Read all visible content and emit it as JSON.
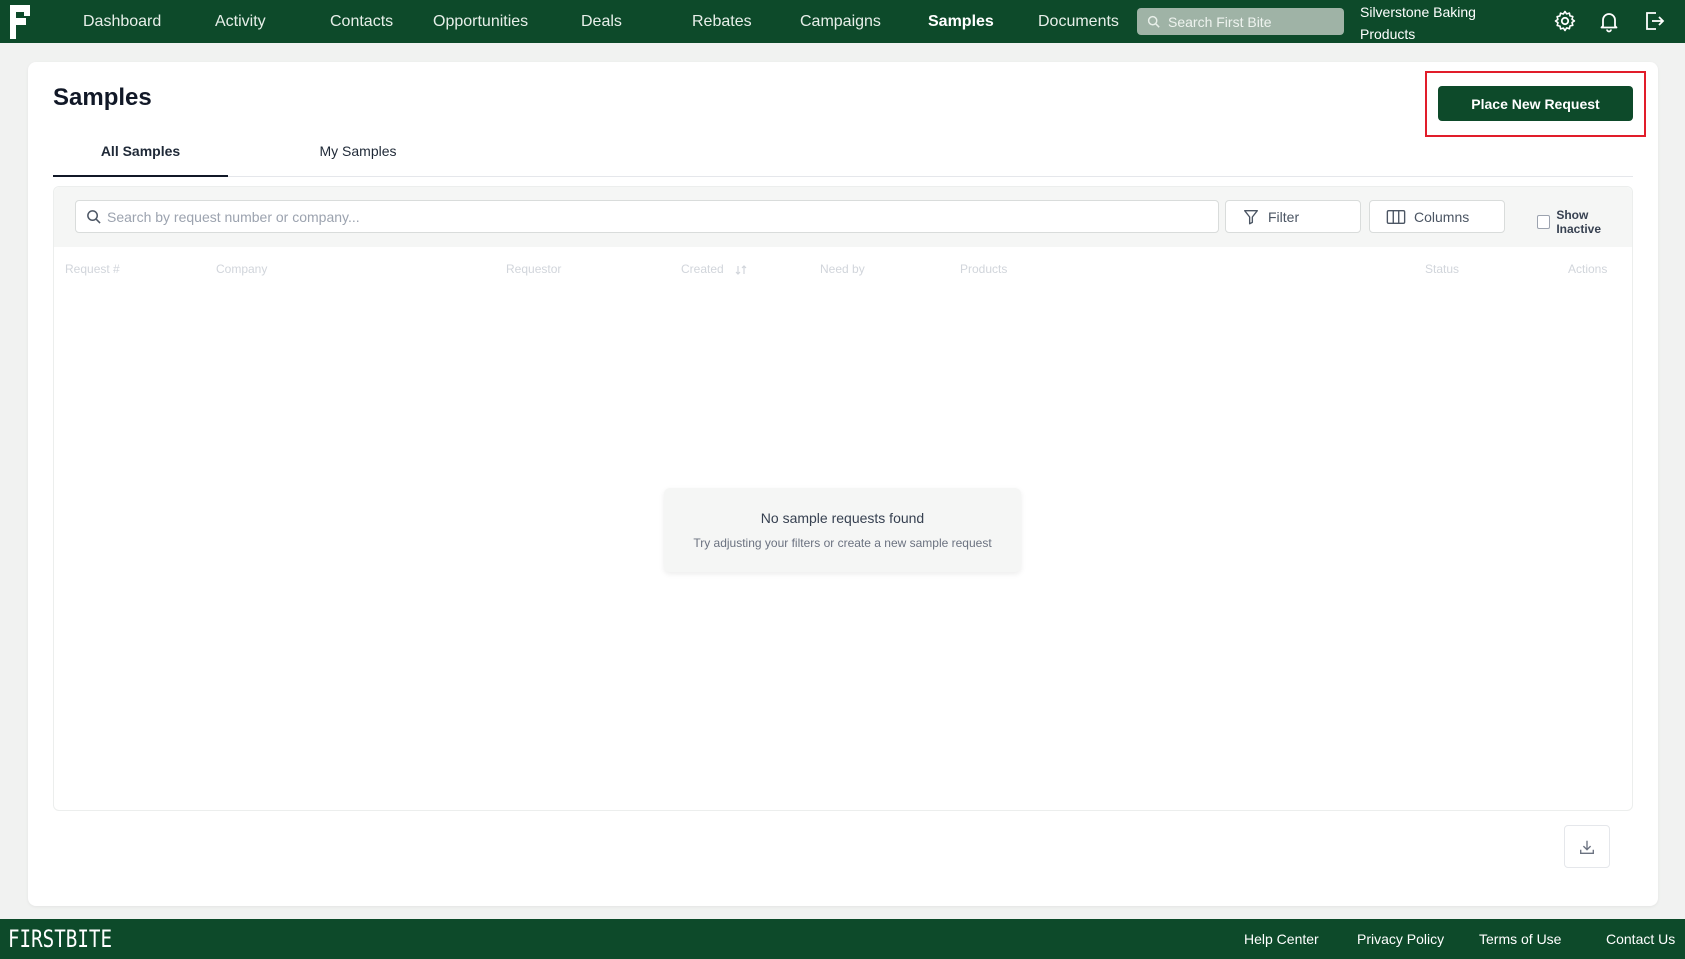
{
  "nav": {
    "items": [
      {
        "label": "Dashboard",
        "active": false
      },
      {
        "label": "Activity",
        "active": false
      },
      {
        "label": "Contacts",
        "active": false
      },
      {
        "label": "Opportunities",
        "active": false
      },
      {
        "label": "Deals",
        "active": false
      },
      {
        "label": "Rebates",
        "active": false
      },
      {
        "label": "Campaigns",
        "active": false
      },
      {
        "label": "Samples",
        "active": true
      },
      {
        "label": "Documents",
        "active": false
      }
    ],
    "search_placeholder": "Search First Bite",
    "org_name": "Silverstone Baking Products",
    "icons": [
      "gear-icon",
      "bell-icon",
      "logout-icon"
    ]
  },
  "page": {
    "title": "Samples",
    "primary_action": "Place New Request",
    "tabs": [
      {
        "label": "All Samples",
        "active": true
      },
      {
        "label": "My Samples",
        "active": false
      }
    ]
  },
  "table": {
    "search_placeholder": "Search by request number or company...",
    "filter_label": "Filter",
    "columns_label": "Columns",
    "show_inactive_label": "Show Inactive",
    "show_inactive_checked": false,
    "columns": [
      "Request #",
      "Company",
      "Requestor",
      "Created",
      "Need by",
      "Products",
      "Status",
      "Actions"
    ],
    "empty_title": "No sample requests found",
    "empty_subtitle": "Try adjusting your filters or create a new sample request"
  },
  "footer": {
    "brand": "FIRSTBITE",
    "links": [
      "Help Center",
      "Privacy Policy",
      "Terms of Use",
      "Contact Us"
    ]
  },
  "colors": {
    "brand_green": "#0d4a2a",
    "highlight_red": "#e11d2a"
  }
}
